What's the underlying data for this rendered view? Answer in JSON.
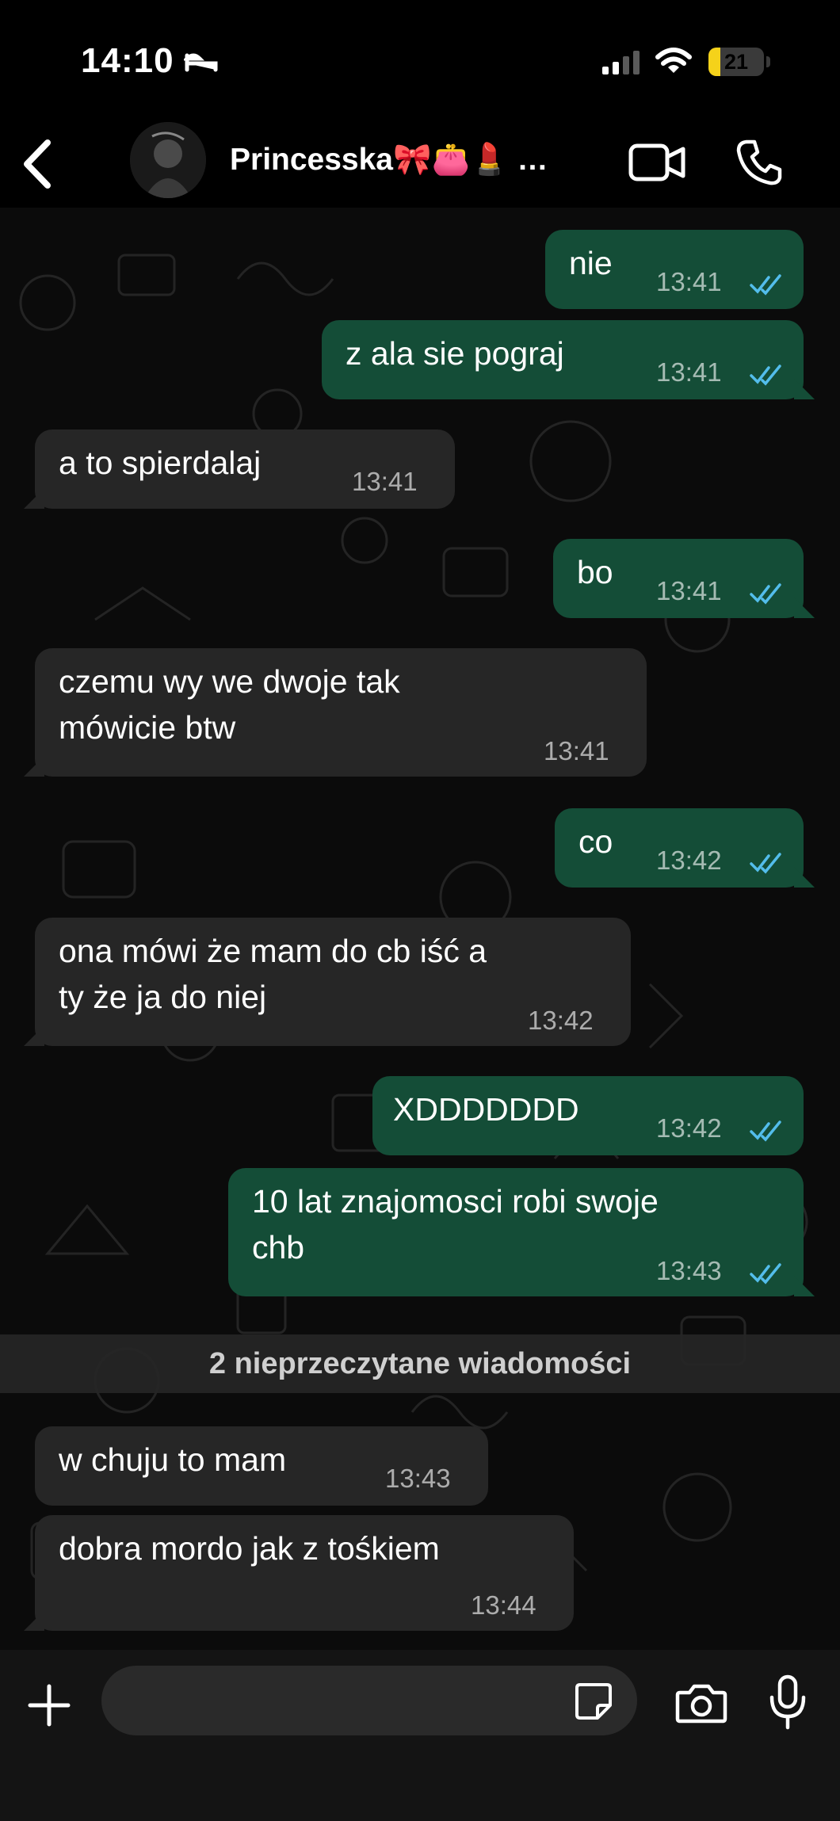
{
  "status": {
    "time": "14:10",
    "battery": "21",
    "battery_level": 0.21,
    "sleep_icon": "sleep-bed-icon",
    "signal_icon": "cellular-signal-icon",
    "wifi_icon": "wifi-icon"
  },
  "header": {
    "contact_name": "Princesska🎀👛💄 …",
    "back_icon": "chevron-left-icon",
    "video_icon": "video-camera-icon",
    "voice_icon": "phone-icon"
  },
  "colors": {
    "outgoing_bubble": "#144d37",
    "incoming_bubble": "#262626",
    "read_ticks": "#53bdeb"
  },
  "messages": [
    {
      "direction": "out",
      "lines": [
        "nie"
      ],
      "time": "13:41",
      "read": true
    },
    {
      "direction": "out",
      "lines": [
        "z ala sie pograj"
      ],
      "time": "13:41",
      "read": true
    },
    {
      "direction": "in",
      "lines": [
        "a to spierdalaj"
      ],
      "time": "13:41"
    },
    {
      "direction": "out",
      "lines": [
        "bo"
      ],
      "time": "13:41",
      "read": true
    },
    {
      "direction": "in",
      "lines": [
        "czemu wy we dwoje tak",
        "mówicie btw"
      ],
      "time": "13:41"
    },
    {
      "direction": "out",
      "lines": [
        "co"
      ],
      "time": "13:42",
      "read": true
    },
    {
      "direction": "in",
      "lines": [
        "ona mówi że mam do cb iść a",
        "ty że ja do niej"
      ],
      "time": "13:42"
    },
    {
      "direction": "out",
      "lines": [
        "XDDDDDDD"
      ],
      "time": "13:42",
      "read": true
    },
    {
      "direction": "out",
      "lines": [
        "10 lat znajomosci robi swoje",
        "chb"
      ],
      "time": "13:43",
      "read": true
    },
    {
      "direction": "in",
      "lines": [
        "w chuju to mam"
      ],
      "time": "13:43"
    },
    {
      "direction": "in",
      "lines": [
        "dobra mordo jak z tośkiem"
      ],
      "time": "13:44"
    }
  ],
  "unread_banner": "2 nieprzeczytane wiadomości",
  "input": {
    "placeholder": "",
    "add_icon": "plus-icon",
    "sticker_icon": "sticker-icon",
    "camera_icon": "camera-icon",
    "mic_icon": "microphone-icon"
  }
}
